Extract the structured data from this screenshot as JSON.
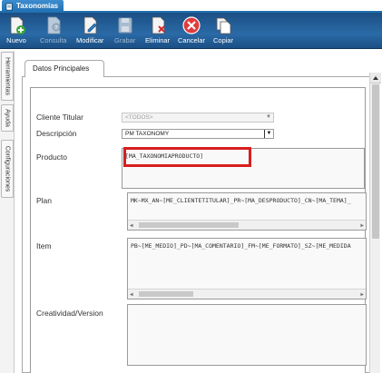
{
  "window": {
    "tab_title": "Taxonomías"
  },
  "toolbar": {
    "nuevo": "Nuevo",
    "consulta": "Consulta",
    "modificar": "Modificar",
    "grabar": "Grabar",
    "eliminar": "Eliminar",
    "cancelar": "Cancelar",
    "copiar": "Copiar"
  },
  "sidetabs": [
    "Herramientas",
    "Ayuda",
    "Configuraciones"
  ],
  "panel": {
    "tab_label": "Datos Principales"
  },
  "form": {
    "cliente_titular": {
      "label": "Cliente Titular",
      "value": "<TODOS>"
    },
    "descripcion": {
      "label": "Descripción",
      "value": "PM TAXONOMY"
    },
    "producto": {
      "label": "Producto",
      "value": "[MA_TAXONOMIAPRODUCTO]"
    },
    "plan": {
      "label": "Plan",
      "value": "MK~MX_AN~[ME_CLIENTETITULAR]_PR~[MA_DESPRODUCTO]_CN~[MA_TEMA]_"
    },
    "item": {
      "label": "Item",
      "value": "PB~[ME_MEDIO]_PD~[MA_COMENTARIO]_FM~[ME_FORMATO]_SZ~[ME_MEDIDA"
    },
    "creatividad": {
      "label": "Creatividad/Version",
      "value": ""
    }
  },
  "colors": {
    "toolbar": "#1f5a94",
    "highlight": "#d81e1e",
    "tab": "#1f6fb0"
  }
}
